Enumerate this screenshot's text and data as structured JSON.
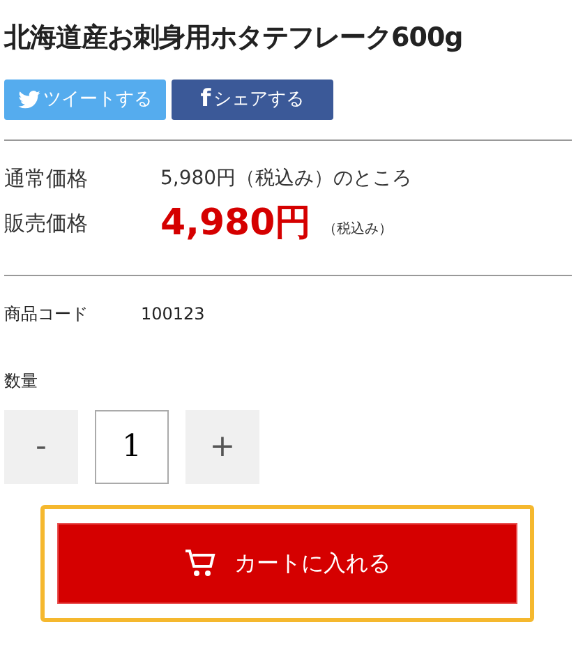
{
  "title": "北海道産お刺身用ホタテフレーク600g",
  "share_buttons": [
    {
      "kind": "twitter",
      "label": "ツイートする"
    },
    {
      "kind": "facebook",
      "icon": "f",
      "label": "シェアする"
    }
  ],
  "prices": [
    {
      "kind": "regular",
      "label": "通常価格",
      "value": "5,980円（税込み）のところ"
    },
    {
      "kind": "sale",
      "label": "販売価格",
      "value": "4,980円",
      "note": "（税込み）"
    }
  ],
  "product_code": {
    "label": "商品コード",
    "value": "100123"
  },
  "quantity": {
    "label": "数量",
    "minus": "-",
    "value": "1",
    "plus": "+"
  },
  "cart_button": {
    "label": "カートに入れる",
    "focused": true
  }
}
